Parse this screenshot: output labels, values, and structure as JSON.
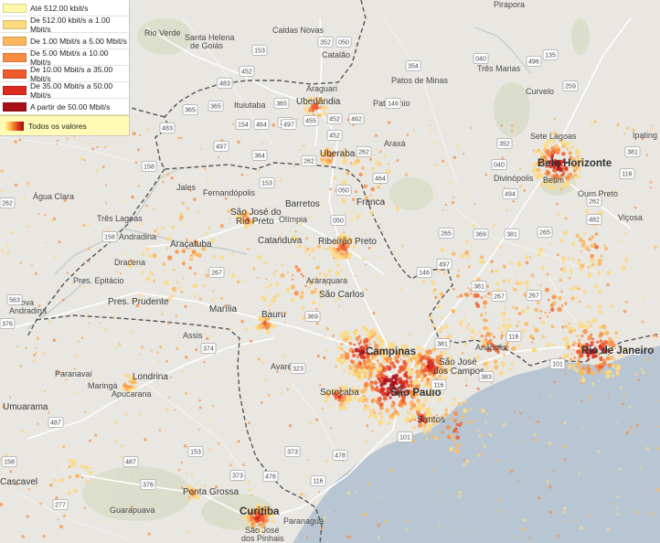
{
  "legend": {
    "items": [
      {
        "label": "Até 512.00 kbit/s",
        "color": "#fff9a8"
      },
      {
        "label": "De 512.00 kbit/s a 1.00 Mbit/s",
        "color": "#fed980"
      },
      {
        "label": "De 1.00 Mbit/s a 5.00 Mbit/s",
        "color": "#fcb65c"
      },
      {
        "label": "De 5.00 Mbit/s a 10.00 Mbit/s",
        "color": "#f98c42"
      },
      {
        "label": "De 10.00 Mbit/s a 35.00 Mbit/s",
        "color": "#ef5a2c"
      },
      {
        "label": "De 35.00 Mbit/s a 50.00 Mbit/s",
        "color": "#dc2a1f"
      },
      {
        "label": "A partir de 50.00 Mbit/s",
        "color": "#a80f19"
      }
    ],
    "all_label": "Todos os valores"
  },
  "places": {
    "pirapora": "Pirapora",
    "rio_verde": "Rio Verde",
    "santa_helena_1": "Santa Helena",
    "santa_helena_2": "de Goiás",
    "caldas_novas": "Caldas Novas",
    "catalao": "Catalão",
    "tres_marias": "Três Marias",
    "patos_de_minas": "Patos de Minas",
    "curvelo": "Curvelo",
    "araguari": "Araguari",
    "uberlandia": "Uberlândia",
    "patrocinio": "Patrocínio",
    "ituiutaba": "Ituiutaba",
    "sete_lagoas": "Sete Lagoas",
    "ipating": "Ipating",
    "belo_horizonte": "Belo Horizonte",
    "betim": "Betim",
    "divinopolis": "Divinópolis",
    "ouro_preto": "Ouro Preto",
    "uberaba": "Uberaba",
    "araxa": "Araxá",
    "jales": "Jales",
    "fernandopolis": "Fernandópolis",
    "agua_clara": "Água Clara",
    "barretos": "Barretos",
    "franca": "Franca",
    "sjrp_1": "São José do",
    "sjrp_2": "Rio Preto",
    "olimpia": "Olímpia",
    "tres_lagoas": "Três Lagoas",
    "andradina": "Andradina",
    "aracatuba": "Araçatuba",
    "catanduva": "Catanduva",
    "ribeirao_preto": "Ribeirão Preto",
    "vicosa": "Viçosa",
    "dracena": "Dracena",
    "pres_epitacio": "Pres. Epitácio",
    "araraquara": "Araraquara",
    "sao_carlos": "São Carlos",
    "pres_prudente": "Pres. Prudente",
    "marilia": "Marília",
    "nova_andradina_1": "Nova",
    "nova_andradina_2": "Andradina",
    "bauru": "Bauru",
    "assis": "Assis",
    "campinas": "Campinas",
    "anapolis": "Anápolis",
    "sjc_1": "São José",
    "sjc_2": "dos Campos",
    "rio_de_janeiro": "Rio de Janeiro",
    "paranavai": "Paranavaí",
    "avare": "Avaré",
    "londrina": "Londrina",
    "maringa": "Maringá",
    "apucarana": "Apucarana",
    "sorocaba": "Sorocaba",
    "sao_paulo": "São Paulo",
    "umuarama": "Umuarama",
    "santos": "Santos",
    "cascavel": "Cascavel",
    "ponta_grossa": "Ponta Grossa",
    "guarapuava": "Guarapuava",
    "curitiba": "Curitiba",
    "paranagua": "Paranaguá",
    "sjp_1": "São José",
    "sjp_2": "dos Pinhais"
  },
  "shields": {
    "s050a": "050",
    "s352a": "352",
    "s153a": "153",
    "s452a": "452",
    "s483a": "483",
    "s365a": "365",
    "s365b": "365",
    "s354": "354",
    "s040": "040",
    "s496": "496",
    "s135": "135",
    "s365c": "365",
    "s262a": "262",
    "s452b": "452",
    "s462": "462",
    "s259": "259",
    "s483b": "483",
    "s154": "154",
    "s464a": "464",
    "s497a": "497",
    "s455": "455",
    "s452c": "452",
    "s146a": "146",
    "s352b": "352",
    "s381a": "381",
    "s497b": "497",
    "s364": "364",
    "s262b": "262",
    "s262c": "262",
    "s040b": "040",
    "s158a": "158",
    "s153b": "153",
    "s464b": "464",
    "s050b": "050",
    "s494": "494",
    "s116a": "116",
    "s262d": "262",
    "s262e": "262",
    "s050c": "050",
    "s482": "482",
    "s158b": "158",
    "s265a": "265",
    "s369a": "369",
    "s381b": "381",
    "s265b": "265",
    "s267a": "267",
    "s146b": "146",
    "s497c": "497",
    "s381c": "381",
    "s267b": "267",
    "s563": "563",
    "s267c": "267",
    "s369b": "369",
    "s116b": "116",
    "s376": "376",
    "s374": "374",
    "s381d": "381",
    "s101a": "101",
    "s323": "323",
    "s383": "383",
    "s487a": "487",
    "s153c": "153",
    "s373": "373",
    "s478": "478",
    "s101b": "101",
    "s487b": "487",
    "s476": "476",
    "s116c": "116",
    "s277": "277",
    "s373b": "373",
    "s376b": "376",
    "s158c": "158",
    "s116d": "116"
  }
}
